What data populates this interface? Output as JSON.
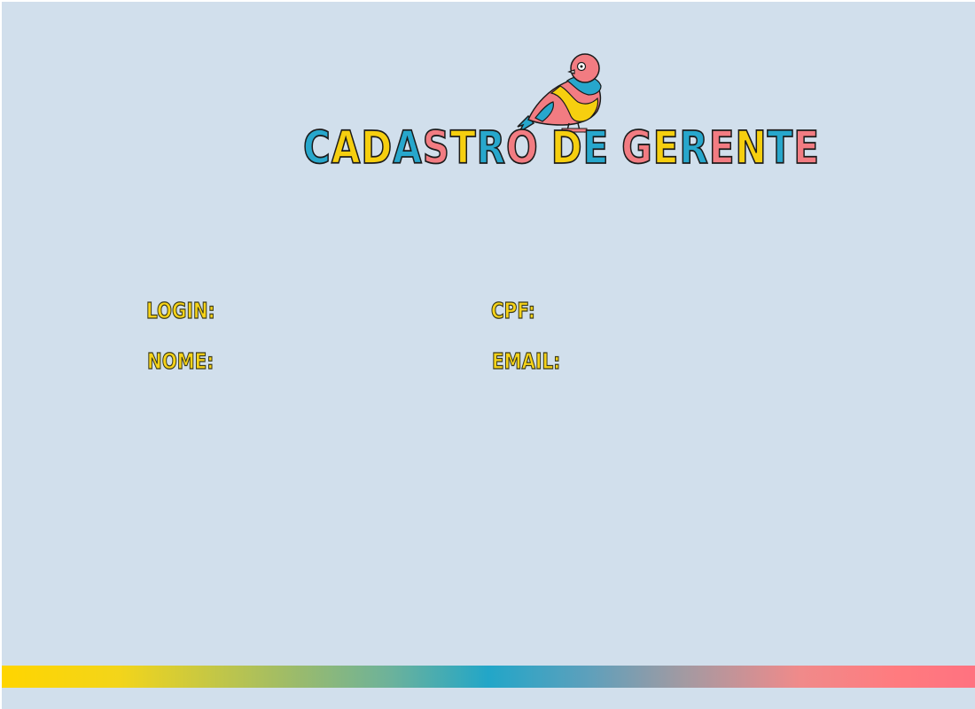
{
  "page": {
    "title_letters": [
      {
        "char": "C",
        "color": "#27a7cc"
      },
      {
        "char": "A",
        "color": "#f6cf0f"
      },
      {
        "char": "D",
        "color": "#f6cf0f"
      },
      {
        "char": "A",
        "color": "#27a7cc"
      },
      {
        "char": "S",
        "color": "#f27c82"
      },
      {
        "char": "T",
        "color": "#f6cf0f"
      },
      {
        "char": "R",
        "color": "#27a7cc"
      },
      {
        "char": "O",
        "color": "#f27c82"
      },
      {
        "char": " ",
        "color": "#000000"
      },
      {
        "char": "D",
        "color": "#f6cf0f"
      },
      {
        "char": "E",
        "color": "#27a7cc"
      },
      {
        "char": " ",
        "color": "#000000"
      },
      {
        "char": "G",
        "color": "#f27c82"
      },
      {
        "char": "E",
        "color": "#f6cf0f"
      },
      {
        "char": "R",
        "color": "#27a7cc"
      },
      {
        "char": "E",
        "color": "#f27c82"
      },
      {
        "char": "N",
        "color": "#f6cf0f"
      },
      {
        "char": "T",
        "color": "#27a7cc"
      },
      {
        "char": "E",
        "color": "#f27c82"
      }
    ],
    "logo_icon": "bird-icon"
  },
  "form": {
    "login_label": "LOGIN:",
    "cpf_label": "CPF:",
    "nome_label": "NOME:",
    "email_label": "EMAIL:",
    "login_value": "",
    "cpf_value": "",
    "nome_value": "",
    "email_value": ""
  },
  "colors": {
    "background": "#d1dfec",
    "yellow": "#f6cf0f",
    "blue": "#27a7cc",
    "pink": "#f27c82"
  }
}
